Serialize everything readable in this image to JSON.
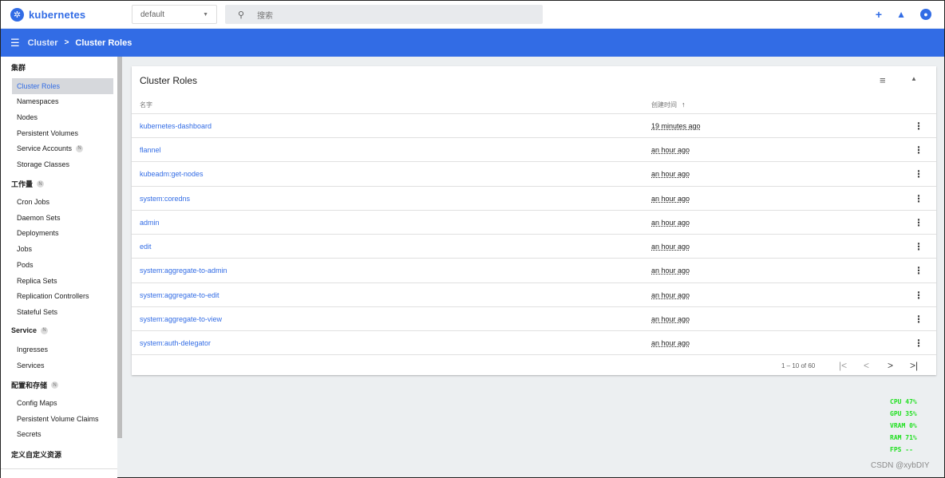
{
  "header": {
    "brand": "kubernetes",
    "namespace": "default",
    "search_placeholder": "搜索",
    "actions": [
      "plus-icon",
      "bell-icon",
      "account-icon"
    ]
  },
  "toolbar": {
    "breadcrumb": [
      "Cluster",
      "Cluster Roles"
    ]
  },
  "sidebar": {
    "groups": [
      {
        "label": "集群",
        "items": [
          "Cluster Roles",
          "Namespaces",
          "Nodes",
          "Persistent Volumes",
          "Service Accounts",
          "Storage Classes"
        ]
      },
      {
        "label": "工作量",
        "items": [
          "Cron Jobs",
          "Daemon Sets",
          "Deployments",
          "Jobs",
          "Pods",
          "Replica Sets",
          "Replication Controllers",
          "Stateful Sets"
        ]
      },
      {
        "label": "Service",
        "items": [
          "Ingresses",
          "Services"
        ]
      },
      {
        "label": "配置和存储",
        "items": [
          "Config Maps",
          "Persistent Volume Claims",
          "Secrets"
        ]
      },
      {
        "label": "定义自定义资源",
        "items": []
      }
    ],
    "active": "Cluster Roles",
    "badge": "N"
  },
  "card": {
    "title": "Cluster Roles",
    "columns": [
      "名字",
      "创建时间"
    ],
    "rows": [
      {
        "name": "kubernetes-dashboard",
        "created": "19 minutes ago"
      },
      {
        "name": "flannel",
        "created": "an hour ago"
      },
      {
        "name": "kubeadm:get-nodes",
        "created": "an hour ago"
      },
      {
        "name": "system:coredns",
        "created": "an hour ago"
      },
      {
        "name": "admin",
        "created": "an hour ago"
      },
      {
        "name": "edit",
        "created": "an hour ago"
      },
      {
        "name": "system:aggregate-to-admin",
        "created": "an hour ago"
      },
      {
        "name": "system:aggregate-to-edit",
        "created": "an hour ago"
      },
      {
        "name": "system:aggregate-to-view",
        "created": "an hour ago"
      },
      {
        "name": "system:auth-delegator",
        "created": "an hour ago"
      }
    ],
    "pagination": "1 – 10 of 60"
  },
  "overlay": {
    "stats": [
      "CPU 47%",
      "GPU 35%",
      "VRAM 0%",
      "RAM 71%",
      "FPS --"
    ],
    "watermark": "CSDN @xybDIY"
  }
}
